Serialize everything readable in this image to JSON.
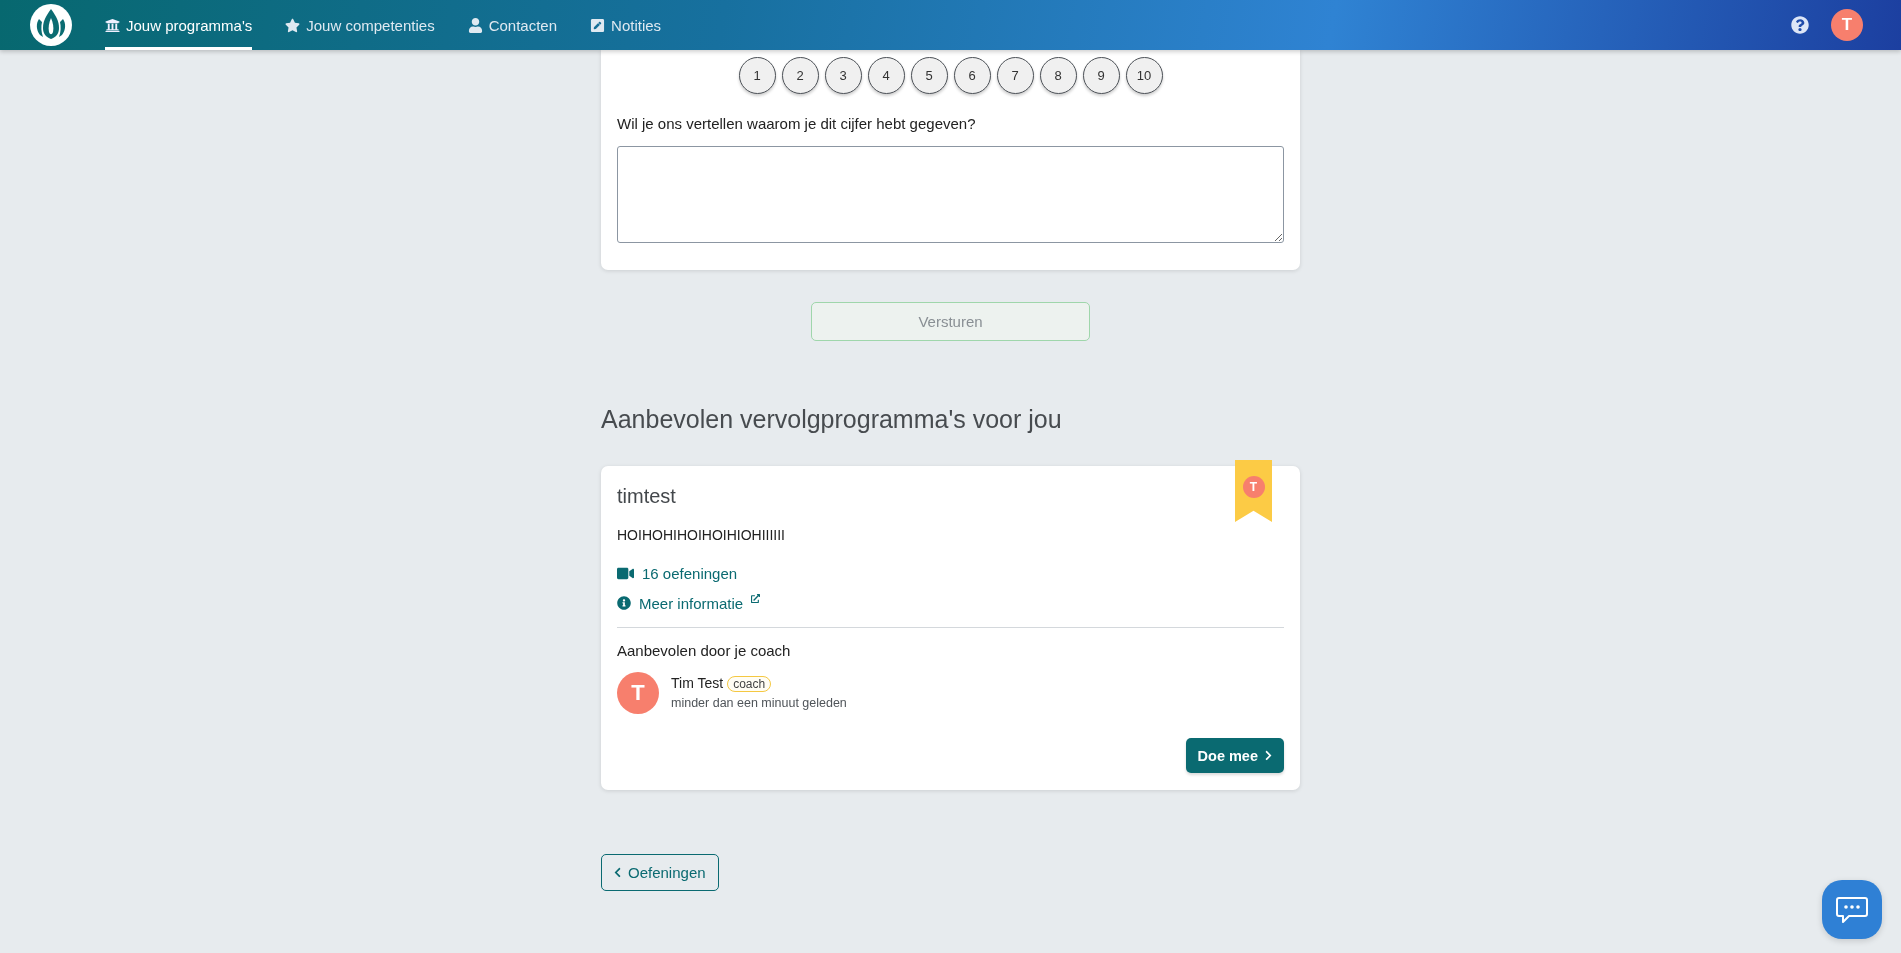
{
  "nav": {
    "items": [
      {
        "kind": "programs",
        "label": "Jouw programma's",
        "selected": true
      },
      {
        "kind": "competences",
        "label": "Jouw competenties",
        "selected": false
      },
      {
        "kind": "contacts",
        "label": "Contacten",
        "selected": false
      },
      {
        "kind": "notes",
        "label": "Notities",
        "selected": false
      }
    ],
    "avatar": {
      "initial": "T"
    }
  },
  "rating": {
    "options": [
      {
        "label": "1",
        "selected": false
      },
      {
        "label": "2",
        "selected": false
      },
      {
        "label": "3",
        "selected": false
      },
      {
        "label": "4",
        "selected": false
      },
      {
        "label": "5",
        "selected": false
      },
      {
        "label": "6",
        "selected": false
      },
      {
        "label": "7",
        "selected": false
      },
      {
        "label": "8",
        "selected": false
      },
      {
        "label": "9",
        "selected": false
      },
      {
        "label": "10",
        "selected": false
      }
    ]
  },
  "feedback": {
    "question": "Wil je ons vertellen waarom je dit cijfer hebt gegeven?",
    "submit": {
      "label": "Versturen",
      "disabled": true
    }
  },
  "recommendations": {
    "heading": "Aanbevolen vervolgprogramma's voor jou",
    "programs": [
      {
        "title": "timtest",
        "ribbon_initial": "T",
        "description": "HOIHOHIHOIHOIHIOHIIIIII",
        "links": [
          {
            "kind": "video",
            "label": "16 oefeningen",
            "external": false
          },
          {
            "kind": "info",
            "label": "Meer informatie",
            "external": true
          }
        ],
        "recommended_by": {
          "heading": "Aanbevolen door je coach",
          "initial": "T",
          "name": "Tim Test",
          "role": "coach",
          "time": "minder dan een minuut geleden"
        },
        "action": "Doe mee"
      }
    ]
  },
  "back_button": {
    "label": "Oefeningen"
  }
}
